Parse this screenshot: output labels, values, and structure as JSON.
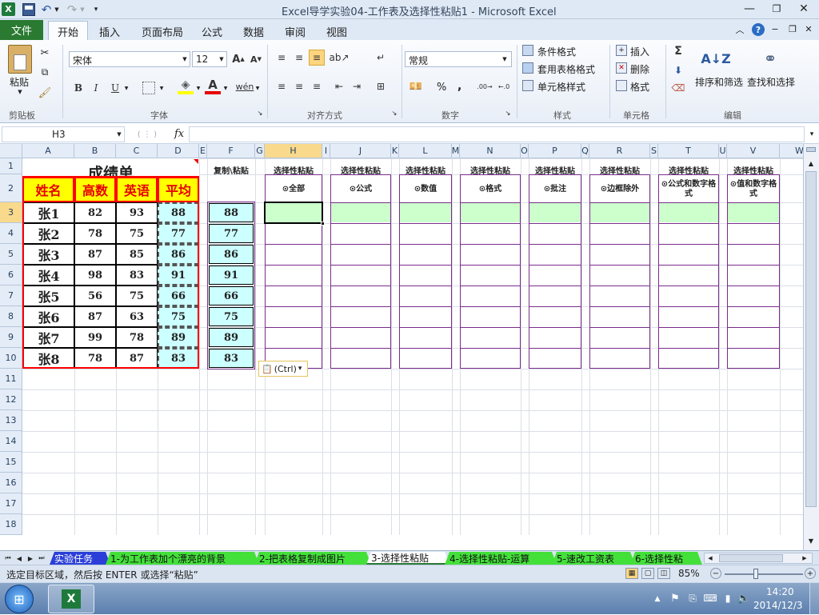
{
  "window": {
    "title": "Excel导学实验04-工作表及选择性粘贴1  -  Microsoft Excel"
  },
  "ribbon": {
    "file_tab": "文件",
    "tabs": [
      "开始",
      "插入",
      "页面布局",
      "公式",
      "数据",
      "审阅",
      "视图"
    ],
    "clipboard": {
      "paste": "粘贴",
      "group": "剪贴板"
    },
    "font": {
      "name": "宋体",
      "size": "12",
      "group": "字体"
    },
    "alignment": {
      "group": "对齐方式"
    },
    "number": {
      "format": "常规",
      "percent": "%",
      "comma": ",",
      "group": "数字"
    },
    "styles": {
      "conditional": "条件格式",
      "table_format": "套用表格格式",
      "cell_styles": "单元格样式",
      "group": "样式"
    },
    "cells": {
      "insert": "插入",
      "delete": "删除",
      "format": "格式",
      "group": "单元格"
    },
    "editing": {
      "sort_filter": "排序和筛选",
      "find_select": "查找和选择",
      "group": "编辑"
    }
  },
  "formula_bar": {
    "name_box": "H3",
    "fx": "fx",
    "value": ""
  },
  "grid": {
    "columns": [
      "A",
      "B",
      "C",
      "D",
      "E",
      "F",
      "G",
      "H",
      "I",
      "J",
      "K",
      "L",
      "M",
      "N",
      "O",
      "P",
      "Q",
      "R",
      "S",
      "T",
      "U",
      "V",
      "W"
    ],
    "rows": [
      "1",
      "2",
      "3",
      "4",
      "5",
      "6",
      "7",
      "8",
      "9",
      "10",
      "11",
      "12",
      "13",
      "14",
      "15",
      "16",
      "17",
      "18"
    ],
    "selected_col": "H",
    "selected_row": "3",
    "grade_table": {
      "title": "成绩单",
      "headers": [
        "姓名",
        "高数",
        "英语",
        "平均"
      ],
      "rows": [
        [
          "张1",
          "82",
          "93",
          "88"
        ],
        [
          "张2",
          "78",
          "75",
          "77"
        ],
        [
          "张3",
          "87",
          "85",
          "86"
        ],
        [
          "张4",
          "98",
          "83",
          "91"
        ],
        [
          "张5",
          "56",
          "75",
          "66"
        ],
        [
          "张6",
          "87",
          "63",
          "75"
        ],
        [
          "张7",
          "99",
          "78",
          "89"
        ],
        [
          "张8",
          "78",
          "87",
          "83"
        ]
      ]
    },
    "copy_paste": {
      "header": "复制\\粘贴",
      "values": [
        "88",
        "77",
        "86",
        "91",
        "66",
        "75",
        "89",
        "83"
      ]
    },
    "paste_special": {
      "header": "选择性粘贴",
      "options": [
        "⊙全部",
        "⊙公式",
        "⊙数值",
        "⊙格式",
        "⊙批注",
        "⊙边框除外",
        "⊙公式和数字格式",
        "⊙值和数字格式"
      ]
    },
    "paste_options_tag": "(Ctrl)"
  },
  "sheet_tabs": [
    "实验任务",
    "1-为工作表加个漂亮的背景",
    "2-把表格复制成图片",
    "3-选择性粘贴",
    "4-选择性粘贴-运算",
    "5-速改工资表",
    "6-选择性粘"
  ],
  "active_sheet": "3-选择性粘贴",
  "status": {
    "message": "选定目标区域，然后按 ENTER 或选择“粘贴”",
    "zoom": "85%"
  },
  "taskbar": {
    "time": "14:20",
    "date": "2014/12/3"
  },
  "colors": {
    "accent": "#2b579a",
    "file_tab": "#2a7a32",
    "header_fill": "#ffff00",
    "header_text": "#e60000",
    "border_red": "#ff0000",
    "cyan_fill": "#ccffff",
    "green_fill": "#ccffcc",
    "purple_border": "#7b2c8c"
  }
}
